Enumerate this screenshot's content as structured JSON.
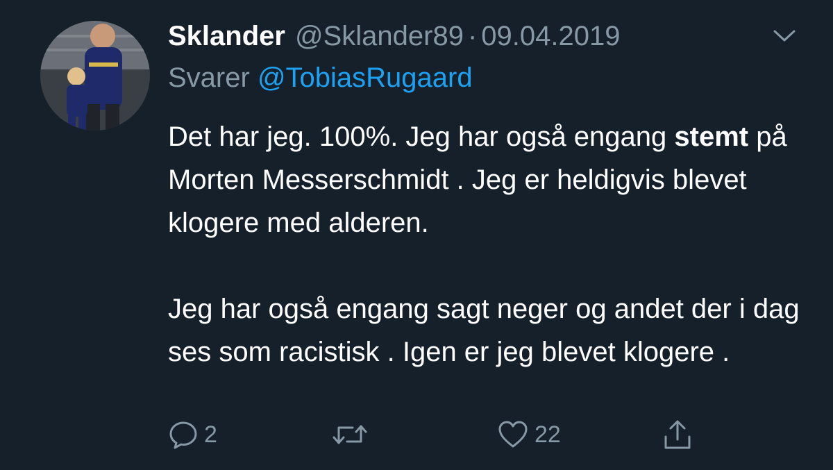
{
  "tweet": {
    "display_name": "Sklander",
    "handle": "@Sklander89",
    "separator": "·",
    "date": "09.04.2019",
    "reply_prefix": "Svarer",
    "reply_to": "@TobiasRugaard",
    "paragraph1": {
      "part1": "Det har jeg. 100%. Jeg har også engang ",
      "bold": "stemt",
      "part2": " på Morten Messerschmidt . Jeg er heldigvis blevet klogere med alderen."
    },
    "paragraph2": "Jeg har også engang sagt neger og andet der i dag ses som racistisk . Igen er jeg blevet klogere ."
  },
  "actions": {
    "reply_count": "2",
    "retweet_count": "",
    "like_count": "22"
  },
  "icons": {
    "more": "chevron-down-icon",
    "reply": "reply-icon",
    "retweet": "retweet-icon",
    "like": "heart-icon",
    "share": "share-icon"
  },
  "colors": {
    "background": "#15202b",
    "primary_text": "#ffffff",
    "secondary_text": "#8899a6",
    "mention": "#1da1f2"
  }
}
